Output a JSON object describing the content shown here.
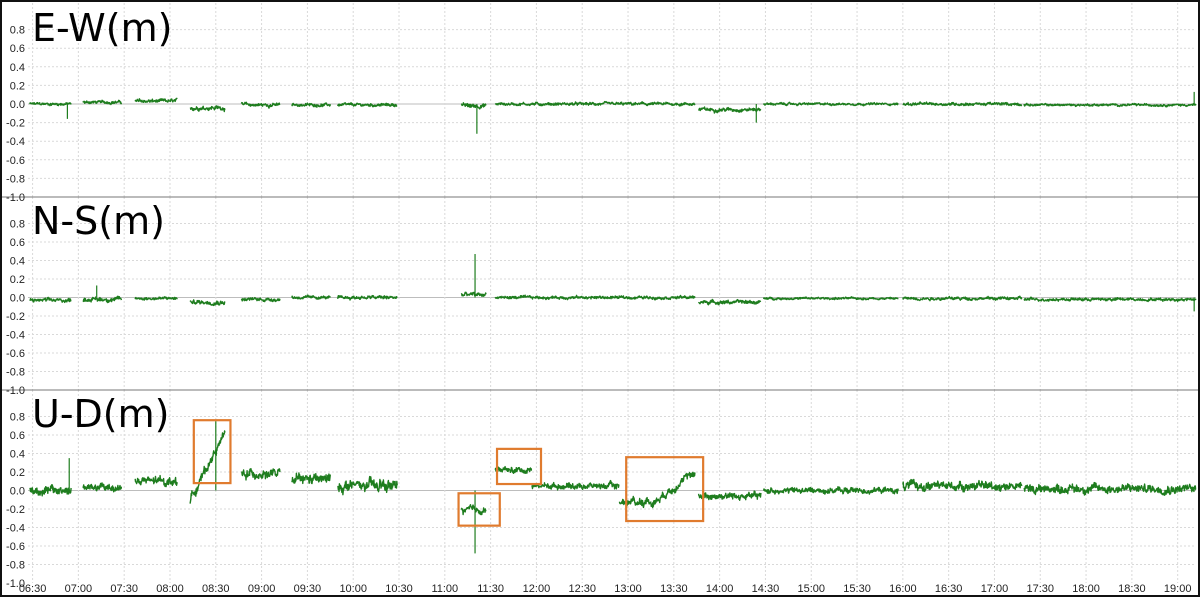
{
  "chart_data": {
    "type": "line",
    "line_color": "#1e7d1e",
    "highlight_color": "#e07b2e",
    "grid": true,
    "x_ticks": [
      "06:30",
      "07:00",
      "07:30",
      "08:00",
      "08:30",
      "09:00",
      "09:30",
      "10:00",
      "10:30",
      "11:00",
      "11:30",
      "12:00",
      "12:30",
      "13:00",
      "13:30",
      "14:00",
      "14:30",
      "15:00",
      "15:30",
      "16:00",
      "16:30",
      "17:00",
      "17:30",
      "18:00",
      "18:30",
      "19:00"
    ],
    "x_range_hours": [
      6.45,
      19.2
    ],
    "y_ticks": [
      "0.8",
      "0.6",
      "0.4",
      "0.2",
      "0.0",
      "-0.2",
      "-0.4",
      "-0.6",
      "-0.8",
      "-1.0"
    ],
    "ylim": [
      -1.0,
      1.0
    ],
    "panels": [
      {
        "title": "E-W(m)",
        "segments": [
          {
            "start": 6.47,
            "end": 6.92,
            "level": 0.0,
            "noise": 0.02
          },
          {
            "start": 7.05,
            "end": 7.47,
            "level": 0.02,
            "noise": 0.02
          },
          {
            "start": 7.62,
            "end": 8.08,
            "level": 0.03,
            "noise": 0.025
          },
          {
            "start": 8.22,
            "end": 8.6,
            "level": -0.04,
            "noise": 0.03
          },
          {
            "start": 8.78,
            "end": 9.2,
            "level": -0.01,
            "noise": 0.025
          },
          {
            "start": 9.33,
            "end": 9.75,
            "level": -0.01,
            "noise": 0.02
          },
          {
            "start": 9.83,
            "end": 10.48,
            "level": -0.01,
            "noise": 0.02
          },
          {
            "start": 11.18,
            "end": 11.45,
            "level": -0.02,
            "noise": 0.03
          },
          {
            "start": 11.55,
            "end": 13.73,
            "level": 0.0,
            "noise": 0.02
          },
          {
            "start": 13.77,
            "end": 14.45,
            "level": -0.06,
            "noise": 0.025
          },
          {
            "start": 14.48,
            "end": 15.95,
            "level": 0.0,
            "noise": 0.015
          },
          {
            "start": 16.0,
            "end": 17.3,
            "level": 0.0,
            "noise": 0.02
          },
          {
            "start": 17.32,
            "end": 19.2,
            "level": -0.01,
            "noise": 0.015
          }
        ],
        "spikes": [
          {
            "t": 6.88,
            "value": -0.16
          },
          {
            "t": 11.35,
            "value": -0.32
          },
          {
            "t": 14.4,
            "value": -0.2
          },
          {
            "t": 19.18,
            "value": 0.13
          }
        ]
      },
      {
        "title": "N-S(m)",
        "segments": [
          {
            "start": 6.47,
            "end": 6.92,
            "level": -0.03,
            "noise": 0.025
          },
          {
            "start": 7.05,
            "end": 7.47,
            "level": -0.02,
            "noise": 0.03
          },
          {
            "start": 7.62,
            "end": 8.08,
            "level": -0.01,
            "noise": 0.02
          },
          {
            "start": 8.22,
            "end": 8.6,
            "level": -0.05,
            "noise": 0.03
          },
          {
            "start": 8.78,
            "end": 9.2,
            "level": -0.02,
            "noise": 0.025
          },
          {
            "start": 9.33,
            "end": 9.75,
            "level": 0.0,
            "noise": 0.02
          },
          {
            "start": 9.83,
            "end": 10.48,
            "level": 0.0,
            "noise": 0.025
          },
          {
            "start": 11.18,
            "end": 11.45,
            "level": 0.03,
            "noise": 0.03
          },
          {
            "start": 11.55,
            "end": 13.73,
            "level": 0.0,
            "noise": 0.02
          },
          {
            "start": 13.77,
            "end": 14.45,
            "level": -0.05,
            "noise": 0.025
          },
          {
            "start": 14.48,
            "end": 15.95,
            "level": -0.01,
            "noise": 0.015
          },
          {
            "start": 16.0,
            "end": 17.3,
            "level": -0.01,
            "noise": 0.02
          },
          {
            "start": 17.32,
            "end": 19.2,
            "level": -0.02,
            "noise": 0.02
          }
        ],
        "spikes": [
          {
            "t": 11.33,
            "value": 0.47
          },
          {
            "t": 7.2,
            "value": 0.13
          },
          {
            "t": 19.18,
            "value": -0.15
          }
        ]
      },
      {
        "title": "U-D(m)",
        "segments": [
          {
            "start": 6.47,
            "end": 6.92,
            "level": 0.0,
            "noise": 0.06
          },
          {
            "start": 7.05,
            "end": 7.47,
            "level": 0.03,
            "noise": 0.05
          },
          {
            "start": 7.62,
            "end": 8.08,
            "level": 0.1,
            "noise": 0.06
          },
          {
            "start": 8.22,
            "end": 8.6,
            "level_start": -0.1,
            "level_end": 0.62,
            "noise": 0.06
          },
          {
            "start": 8.78,
            "end": 9.2,
            "level": 0.18,
            "noise": 0.06
          },
          {
            "start": 9.33,
            "end": 9.75,
            "level": 0.12,
            "noise": 0.07
          },
          {
            "start": 9.83,
            "end": 10.48,
            "level": 0.05,
            "noise": 0.08
          },
          {
            "start": 11.18,
            "end": 11.45,
            "level": -0.21,
            "noise": 0.05
          },
          {
            "start": 11.55,
            "end": 11.95,
            "level": 0.22,
            "noise": 0.04
          },
          {
            "start": 11.95,
            "end": 12.9,
            "level": 0.05,
            "noise": 0.04
          },
          {
            "start": 12.9,
            "end": 13.25,
            "level": -0.12,
            "noise": 0.06
          },
          {
            "start": 13.25,
            "end": 13.73,
            "level_start": -0.15,
            "level_end": 0.2,
            "noise": 0.05
          },
          {
            "start": 13.77,
            "end": 14.45,
            "level": -0.06,
            "noise": 0.05
          },
          {
            "start": 14.48,
            "end": 15.95,
            "level": 0.0,
            "noise": 0.04
          },
          {
            "start": 16.0,
            "end": 17.3,
            "level": 0.05,
            "noise": 0.06
          },
          {
            "start": 17.32,
            "end": 19.2,
            "level": 0.02,
            "noise": 0.06
          }
        ],
        "spikes": [
          {
            "t": 11.33,
            "value": -0.68
          },
          {
            "t": 6.9,
            "value": 0.35
          },
          {
            "t": 8.5,
            "value": 0.75
          }
        ],
        "highlights": [
          {
            "t_start": 8.26,
            "t_end": 8.66,
            "y_low": 0.08,
            "y_high": 0.76
          },
          {
            "t_start": 11.15,
            "t_end": 11.6,
            "y_low": -0.38,
            "y_high": -0.03
          },
          {
            "t_start": 11.57,
            "t_end": 12.05,
            "y_low": 0.07,
            "y_high": 0.45
          },
          {
            "t_start": 12.98,
            "t_end": 13.82,
            "y_low": -0.33,
            "y_high": 0.36
          }
        ]
      }
    ]
  }
}
